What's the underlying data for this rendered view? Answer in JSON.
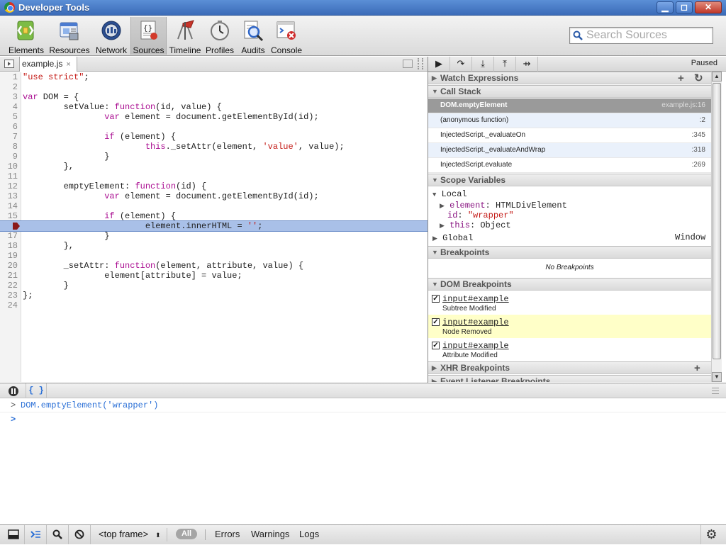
{
  "window": {
    "title": "Developer Tools",
    "controls": [
      "▁",
      "◻",
      "✕"
    ]
  },
  "toolbar": {
    "tabs": [
      {
        "label": "Elements",
        "icon": "elements-icon",
        "color": "#69a838"
      },
      {
        "label": "Resources",
        "icon": "resources-icon",
        "color": "#4b7bd0"
      },
      {
        "label": "Network",
        "icon": "network-icon",
        "color": "#2c4f92"
      },
      {
        "label": "Sources",
        "icon": "sources-icon",
        "color": "#d9d9d9",
        "active": true
      },
      {
        "label": "Timeline",
        "icon": "timeline-icon",
        "color": "#c8342a"
      },
      {
        "label": "Profiles",
        "icon": "profiles-icon",
        "color": "#b0b0b0"
      },
      {
        "label": "Audits",
        "icon": "audits-icon",
        "color": "#2f66c7"
      },
      {
        "label": "Console",
        "icon": "console-icon",
        "color": "#cf2b2b"
      }
    ],
    "search_placeholder": "Search Sources"
  },
  "editor": {
    "file_tab": "example.js",
    "close_glyph": "×",
    "execution_line": 16,
    "lines": [
      {
        "n": "1",
        "code": "\"use strict\";"
      },
      {
        "n": "2",
        "code": ""
      },
      {
        "n": "3",
        "code": "var DOM = {"
      },
      {
        "n": "4",
        "code": "        setValue: function(id, value) {"
      },
      {
        "n": "5",
        "code": "                var element = document.getElementById(id);"
      },
      {
        "n": "6",
        "code": ""
      },
      {
        "n": "7",
        "code": "                if (element) {"
      },
      {
        "n": "8",
        "code": "                        this._setAttr(element, 'value', value);"
      },
      {
        "n": "9",
        "code": "                }"
      },
      {
        "n": "10",
        "code": "        },"
      },
      {
        "n": "11",
        "code": ""
      },
      {
        "n": "12",
        "code": "        emptyElement: function(id) {"
      },
      {
        "n": "13",
        "code": "                var element = document.getElementById(id);"
      },
      {
        "n": "14",
        "code": ""
      },
      {
        "n": "15",
        "code": "                if (element) {"
      },
      {
        "n": "",
        "code": "                        element.innerHTML = '';"
      },
      {
        "n": "17",
        "code": "                }"
      },
      {
        "n": "18",
        "code": "        },"
      },
      {
        "n": "19",
        "code": ""
      },
      {
        "n": "20",
        "code": "        _setAttr: function(element, attribute, value) {"
      },
      {
        "n": "21",
        "code": "                element[attribute] = value;"
      },
      {
        "n": "22",
        "code": "        }"
      },
      {
        "n": "23",
        "code": "};"
      },
      {
        "n": "24",
        "code": ""
      }
    ]
  },
  "debugger": {
    "status": "Paused",
    "buttons": [
      {
        "name": "resume-button",
        "glyph": "▶"
      },
      {
        "name": "step-over-button",
        "glyph": "↷"
      },
      {
        "name": "step-into-button",
        "glyph": "⤓"
      },
      {
        "name": "step-out-button",
        "glyph": "⤒"
      },
      {
        "name": "deactivate-breakpoints-button",
        "glyph": "⇸"
      }
    ]
  },
  "sidebar": {
    "watch": {
      "title": "Watch Expressions",
      "add_glyph": "+",
      "refresh_glyph": "↻"
    },
    "call_stack": {
      "title": "Call Stack",
      "frames": [
        {
          "fn": "DOM.emptyElement",
          "loc": "example.js:16"
        },
        {
          "fn": "(anonymous function)",
          "loc": ":2"
        },
        {
          "fn": "InjectedScript._evaluateOn",
          "loc": ":345"
        },
        {
          "fn": "InjectedScript._evaluateAndWrap",
          "loc": ":318"
        },
        {
          "fn": "InjectedScript.evaluate",
          "loc": ":269"
        }
      ]
    },
    "scope": {
      "title": "Scope Variables",
      "local_label": "Local",
      "element_name": "element",
      "element_value": "HTMLDivElement",
      "id_name": "id",
      "id_value": "\"wrapper\"",
      "this_name": "this",
      "this_value": "Object",
      "global_label": "Global",
      "global_value": "Window"
    },
    "breakpoints": {
      "title": "Breakpoints",
      "empty": "No Breakpoints"
    },
    "dom_breakpoints": {
      "title": "DOM Breakpoints",
      "items": [
        {
          "node": "input#example",
          "kind": "Subtree Modified"
        },
        {
          "node": "input#example",
          "kind": "Node Removed"
        },
        {
          "node": "input#example",
          "kind": "Attribute Modified"
        }
      ]
    },
    "xhr": {
      "title": "XHR Breakpoints",
      "add_glyph": "+"
    },
    "event_listener": {
      "title": "Event Listener Breakpoints"
    }
  },
  "console": {
    "pretty_print": "{ }",
    "prompt_glyph": ">",
    "history": [
      "DOM.emptyElement('wrapper')"
    ]
  },
  "statusbar": {
    "frame": "<top frame>",
    "frame_arrows": "⬍",
    "filters": {
      "all": "All",
      "errors": "Errors",
      "warnings": "Warnings",
      "logs": "Logs"
    },
    "settings_glyph": "⚙"
  }
}
